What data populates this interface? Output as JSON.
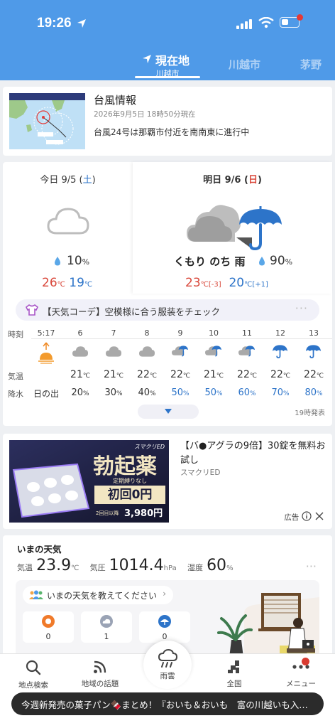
{
  "status_bar": {
    "time": "19:26"
  },
  "tabs": {
    "current_label": "現在地",
    "current_sub": "川越市",
    "other1": "川越市",
    "other2": "茅野"
  },
  "typhoon": {
    "title": "台風情報",
    "date": "2026年9月5日 18時50分現在",
    "message": "台風24号は那覇市付近を南南東に進行中"
  },
  "today": {
    "label_prefix": "今日 9/5 (",
    "weekday": "土",
    "label_suffix": ")",
    "rain": "10",
    "rain_unit": "%",
    "high": "26",
    "low": "19",
    "temp_unit": "℃"
  },
  "tomorrow": {
    "label_prefix": "明日 9/6 (",
    "weekday": "日",
    "label_suffix": ")",
    "weather": "くもり のち 雨",
    "rain": "90",
    "rain_unit": "%",
    "high": "23",
    "high_diff": "[-3]",
    "low": "20",
    "low_diff": "[+1]",
    "temp_unit": "℃"
  },
  "coordinate_banner": {
    "text": "【天気コーデ】空模様に合う服装をチェック"
  },
  "hourly": {
    "labels": {
      "time": "時刻",
      "temp": "気温",
      "rain": "降水"
    },
    "sunrise_time": "5:17",
    "sunrise_label": "日の出",
    "temp_unit": "℃",
    "rain_unit": "%",
    "hours": [
      {
        "hour": "6",
        "temp": "21",
        "rain": "20",
        "icon": "cloud-icon",
        "blue": false
      },
      {
        "hour": "7",
        "temp": "21",
        "rain": "30",
        "icon": "cloud-icon",
        "blue": false
      },
      {
        "hour": "8",
        "temp": "22",
        "rain": "40",
        "icon": "cloud-icon",
        "blue": false
      },
      {
        "hour": "9",
        "temp": "22",
        "rain": "50",
        "icon": "cloud-rain-icon",
        "blue": true
      },
      {
        "hour": "10",
        "temp": "21",
        "rain": "50",
        "icon": "cloud-rain-icon",
        "blue": true
      },
      {
        "hour": "11",
        "temp": "22",
        "rain": "60",
        "icon": "cloud-rain-icon",
        "blue": true
      },
      {
        "hour": "12",
        "temp": "22",
        "rain": "70",
        "icon": "umbrella-icon",
        "blue": true
      },
      {
        "hour": "13",
        "temp": "22",
        "rain": "80",
        "icon": "umbrella-icon",
        "blue": true
      }
    ],
    "announce": "19時発表"
  },
  "ad": {
    "brand": "スマクリED",
    "headline": "勃起薬",
    "subline": "定期縛りなし",
    "offer": "初回0円",
    "offer_note": "2回目以降",
    "price": "3,980円",
    "title": "【バ●アグラの9倍】30錠を無料お試し",
    "sponsor": "スマクリED",
    "label": "広告"
  },
  "current_weather": {
    "title": "いまの天気",
    "temp_label": "気温",
    "temp": "23.9",
    "temp_unit": "℃",
    "pressure_label": "気圧",
    "pressure": "1014.4",
    "pressure_unit": "hPa",
    "humidity_label": "湿度",
    "humidity": "60",
    "humidity_unit": "%",
    "report_prompt": "いまの天気を教えてください",
    "reports": [
      {
        "icon": "sun-icon",
        "count": "0"
      },
      {
        "icon": "cloud-icon",
        "count": "1"
      },
      {
        "icon": "rain-icon",
        "count": "0"
      }
    ]
  },
  "bottom_nav": {
    "search": "地点検索",
    "topics": "地域の話題",
    "radar": "雨雲",
    "national": "全国",
    "menu": "メニュー"
  },
  "ticker": {
    "text": "今週新発売の菓子パン🍫まとめ！『おいも＆おいも　富の川越いも入…"
  },
  "colors": {
    "header": "#4f9ae8",
    "blue_text": "#2d74c9",
    "red_text": "#d9483b"
  }
}
